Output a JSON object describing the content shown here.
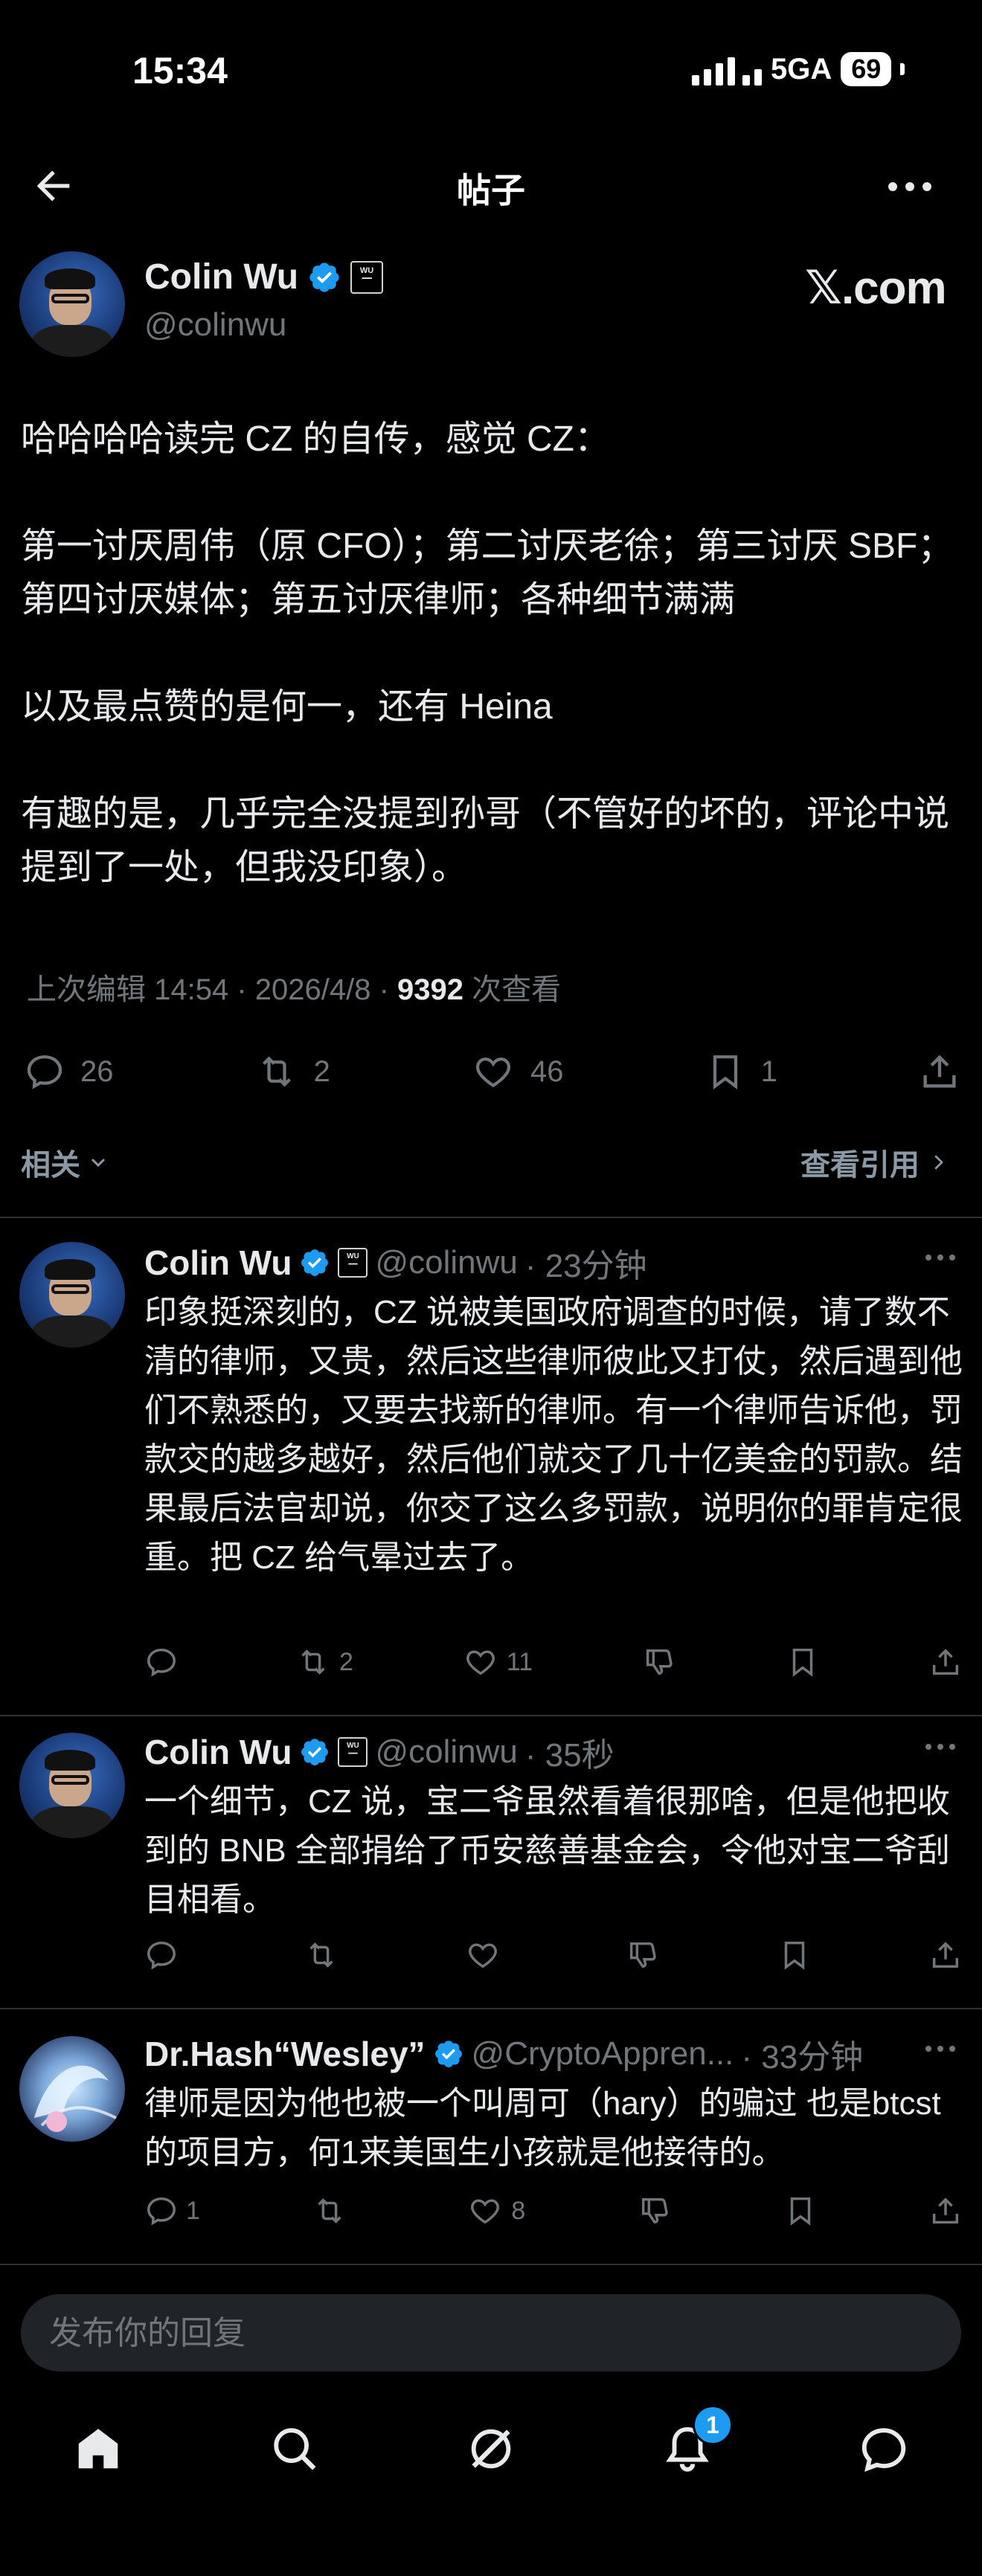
{
  "status_bar": {
    "time": "15:34",
    "network": "5GA",
    "battery": "69"
  },
  "header": {
    "title": "帖子"
  },
  "author": {
    "name": "Colin Wu",
    "handle": "@colinwu",
    "tag_text": "WU BLOCKCHAIN"
  },
  "x_logo": "𝕏.com",
  "post": {
    "paragraphs": [
      "哈哈哈哈读完 CZ 的自传，感觉 CZ：",
      "第一讨厌周伟（原 CFO）；第二讨厌老徐；第三讨厌 SBF；第四讨厌媒体；第五讨厌律师；各种细节满满",
      "以及最点赞的是何一，还有 Heina",
      "有趣的是，几乎完全没提到孙哥（不管好的坏的，评论中说提到了一处，但我没印象）。"
    ],
    "meta_prefix": "上次编辑 14:54 · 2026/4/8 ·",
    "views": "9392",
    "views_label": "次查看"
  },
  "stats": {
    "replies": "26",
    "reposts": "2",
    "likes": "46",
    "bookmarks": "1"
  },
  "related": {
    "label": "相关",
    "quotes_label": "查看引用"
  },
  "replies": [
    {
      "name": "Colin Wu",
      "handle": "@colinwu",
      "time": "· 23分钟",
      "text": "印象挺深刻的，CZ 说被美国政府调查的时候，请了数不清的律师，又贵，然后这些律师彼此又打仗，然后遇到他们不熟悉的，又要去找新的律师。有一个律师告诉他，罚款交的越多越好，然后他们就交了几十亿美金的罚款。结果最后法官却说，你交了这么多罚款，说明你的罪肯定很重。把 CZ 给气晕过去了。",
      "replies": "",
      "reposts": "2",
      "likes": "11"
    },
    {
      "name": "Colin Wu",
      "handle": "@colinwu",
      "time": "· 35秒",
      "text": "一个细节，CZ 说，宝二爷虽然看着很那啥，但是他把收到的 BNB 全部捐给了币安慈善基金会，令他对宝二爷刮目相看。",
      "replies": "",
      "reposts": "",
      "likes": ""
    },
    {
      "name": "Dr.Hash“Wesley”",
      "handle": "@CryptoAppren...",
      "time": "· 33分钟",
      "text": "律师是因为他也被一个叫周可（hary）的骗过 也是btcst的项目方，何1来美国生小孩就是他接待的。",
      "replies": "1",
      "reposts": "",
      "likes": "8"
    }
  ],
  "composer": {
    "placeholder": "发布你的回复"
  },
  "nav": {
    "notification_count": "1"
  },
  "colors": {
    "accent": "#1d9bf0",
    "background": "#000000",
    "muted": "#71767b",
    "text": "#e7e9ea"
  }
}
